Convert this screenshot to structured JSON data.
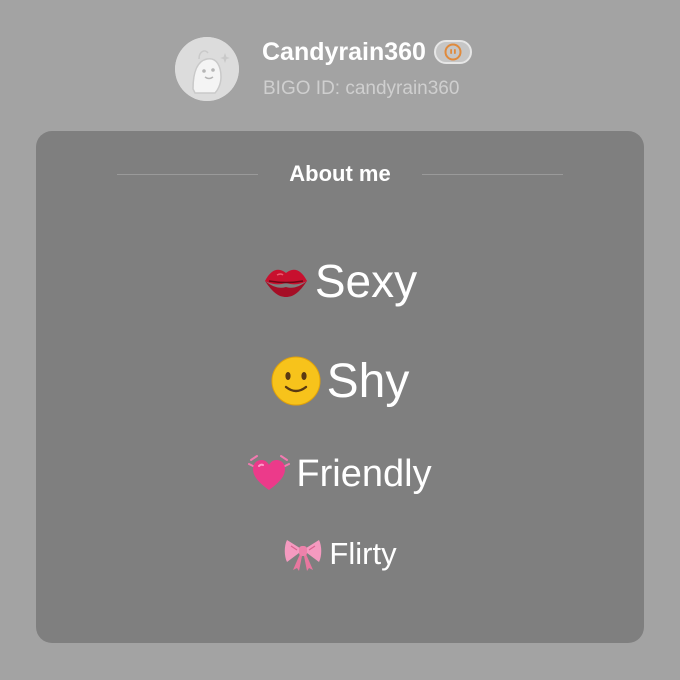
{
  "profile": {
    "username": "Candyrain360",
    "bigo_id": "BIGO ID: candyrain360",
    "avatar_icon": "mascot-avatar-icon",
    "badge_icon": "level-badge-icon"
  },
  "about": {
    "title": "About me",
    "traits": [
      {
        "emoji": "kiss-mark-icon",
        "label": "Sexy"
      },
      {
        "emoji": "smiling-face-icon",
        "label": "Shy"
      },
      {
        "emoji": "beating-heart-icon",
        "label": "Friendly"
      },
      {
        "emoji": "ribbon-bow-icon",
        "label": "Flirty"
      }
    ]
  },
  "colors": {
    "background": "#a3a3a3",
    "card": "#7f7f7f",
    "text": "#ffffff",
    "subtext": "#cfcfcf",
    "badge_accent": "#e08a3c"
  }
}
